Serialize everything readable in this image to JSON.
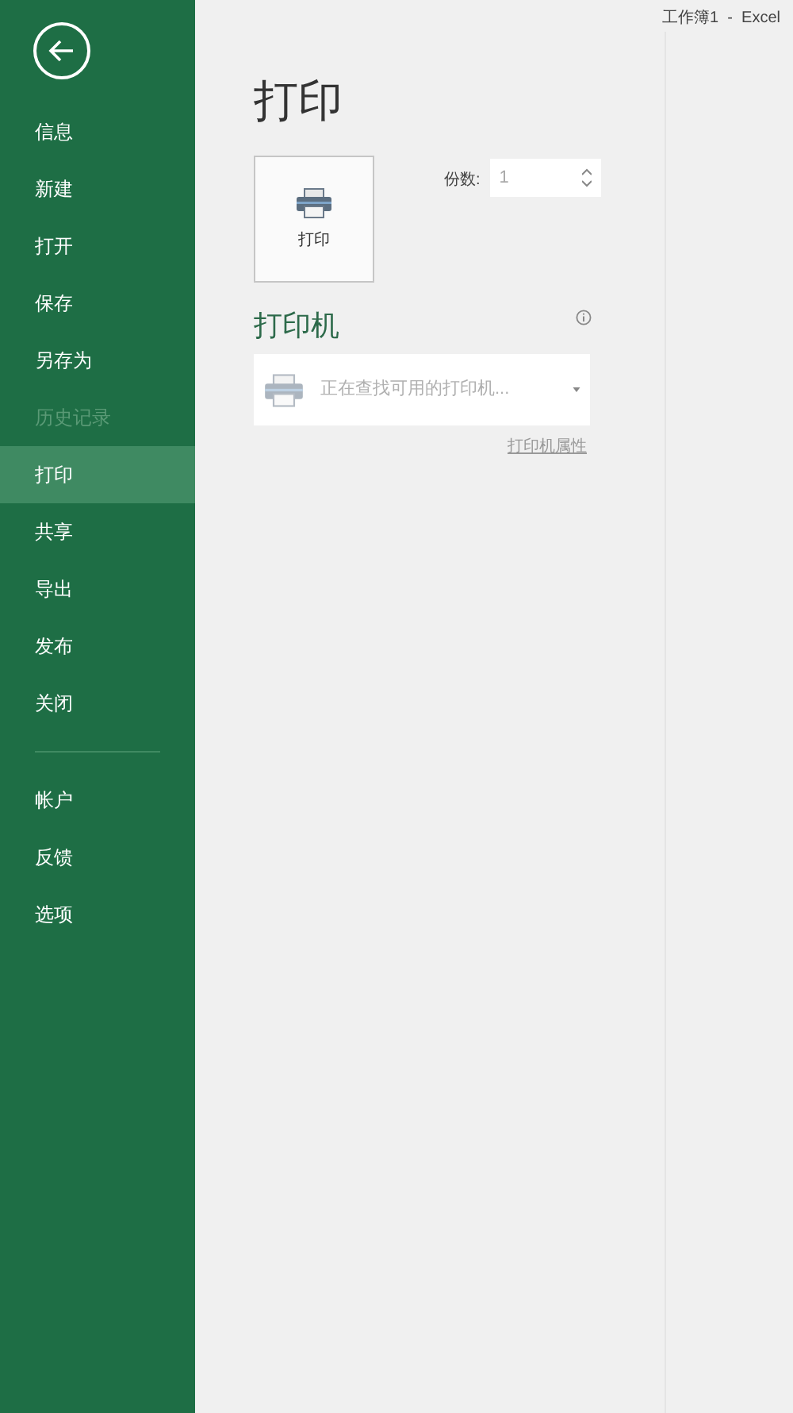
{
  "window": {
    "title": "工作簿1  -  Excel"
  },
  "sidebar": {
    "items": [
      {
        "label": "信息",
        "selected": false,
        "disabled": false
      },
      {
        "label": "新建",
        "selected": false,
        "disabled": false
      },
      {
        "label": "打开",
        "selected": false,
        "disabled": false
      },
      {
        "label": "保存",
        "selected": false,
        "disabled": false
      },
      {
        "label": "另存为",
        "selected": false,
        "disabled": false
      },
      {
        "label": "历史记录",
        "selected": false,
        "disabled": true
      },
      {
        "label": "打印",
        "selected": true,
        "disabled": false
      },
      {
        "label": "共享",
        "selected": false,
        "disabled": false
      },
      {
        "label": "导出",
        "selected": false,
        "disabled": false
      },
      {
        "label": "发布",
        "selected": false,
        "disabled": false
      },
      {
        "label": "关闭",
        "selected": false,
        "disabled": false
      }
    ],
    "bottom_items": [
      {
        "label": "帐户",
        "selected": false,
        "disabled": false
      },
      {
        "label": "反馈",
        "selected": false,
        "disabled": false
      },
      {
        "label": "选项",
        "selected": false,
        "disabled": false
      }
    ]
  },
  "page": {
    "title": "打印",
    "print_button": "打印",
    "copies": {
      "label": "份数:",
      "value": "1"
    },
    "printer": {
      "heading": "打印机",
      "selection": "正在查找可用的打印机...",
      "properties_link": "打印机属性"
    }
  }
}
